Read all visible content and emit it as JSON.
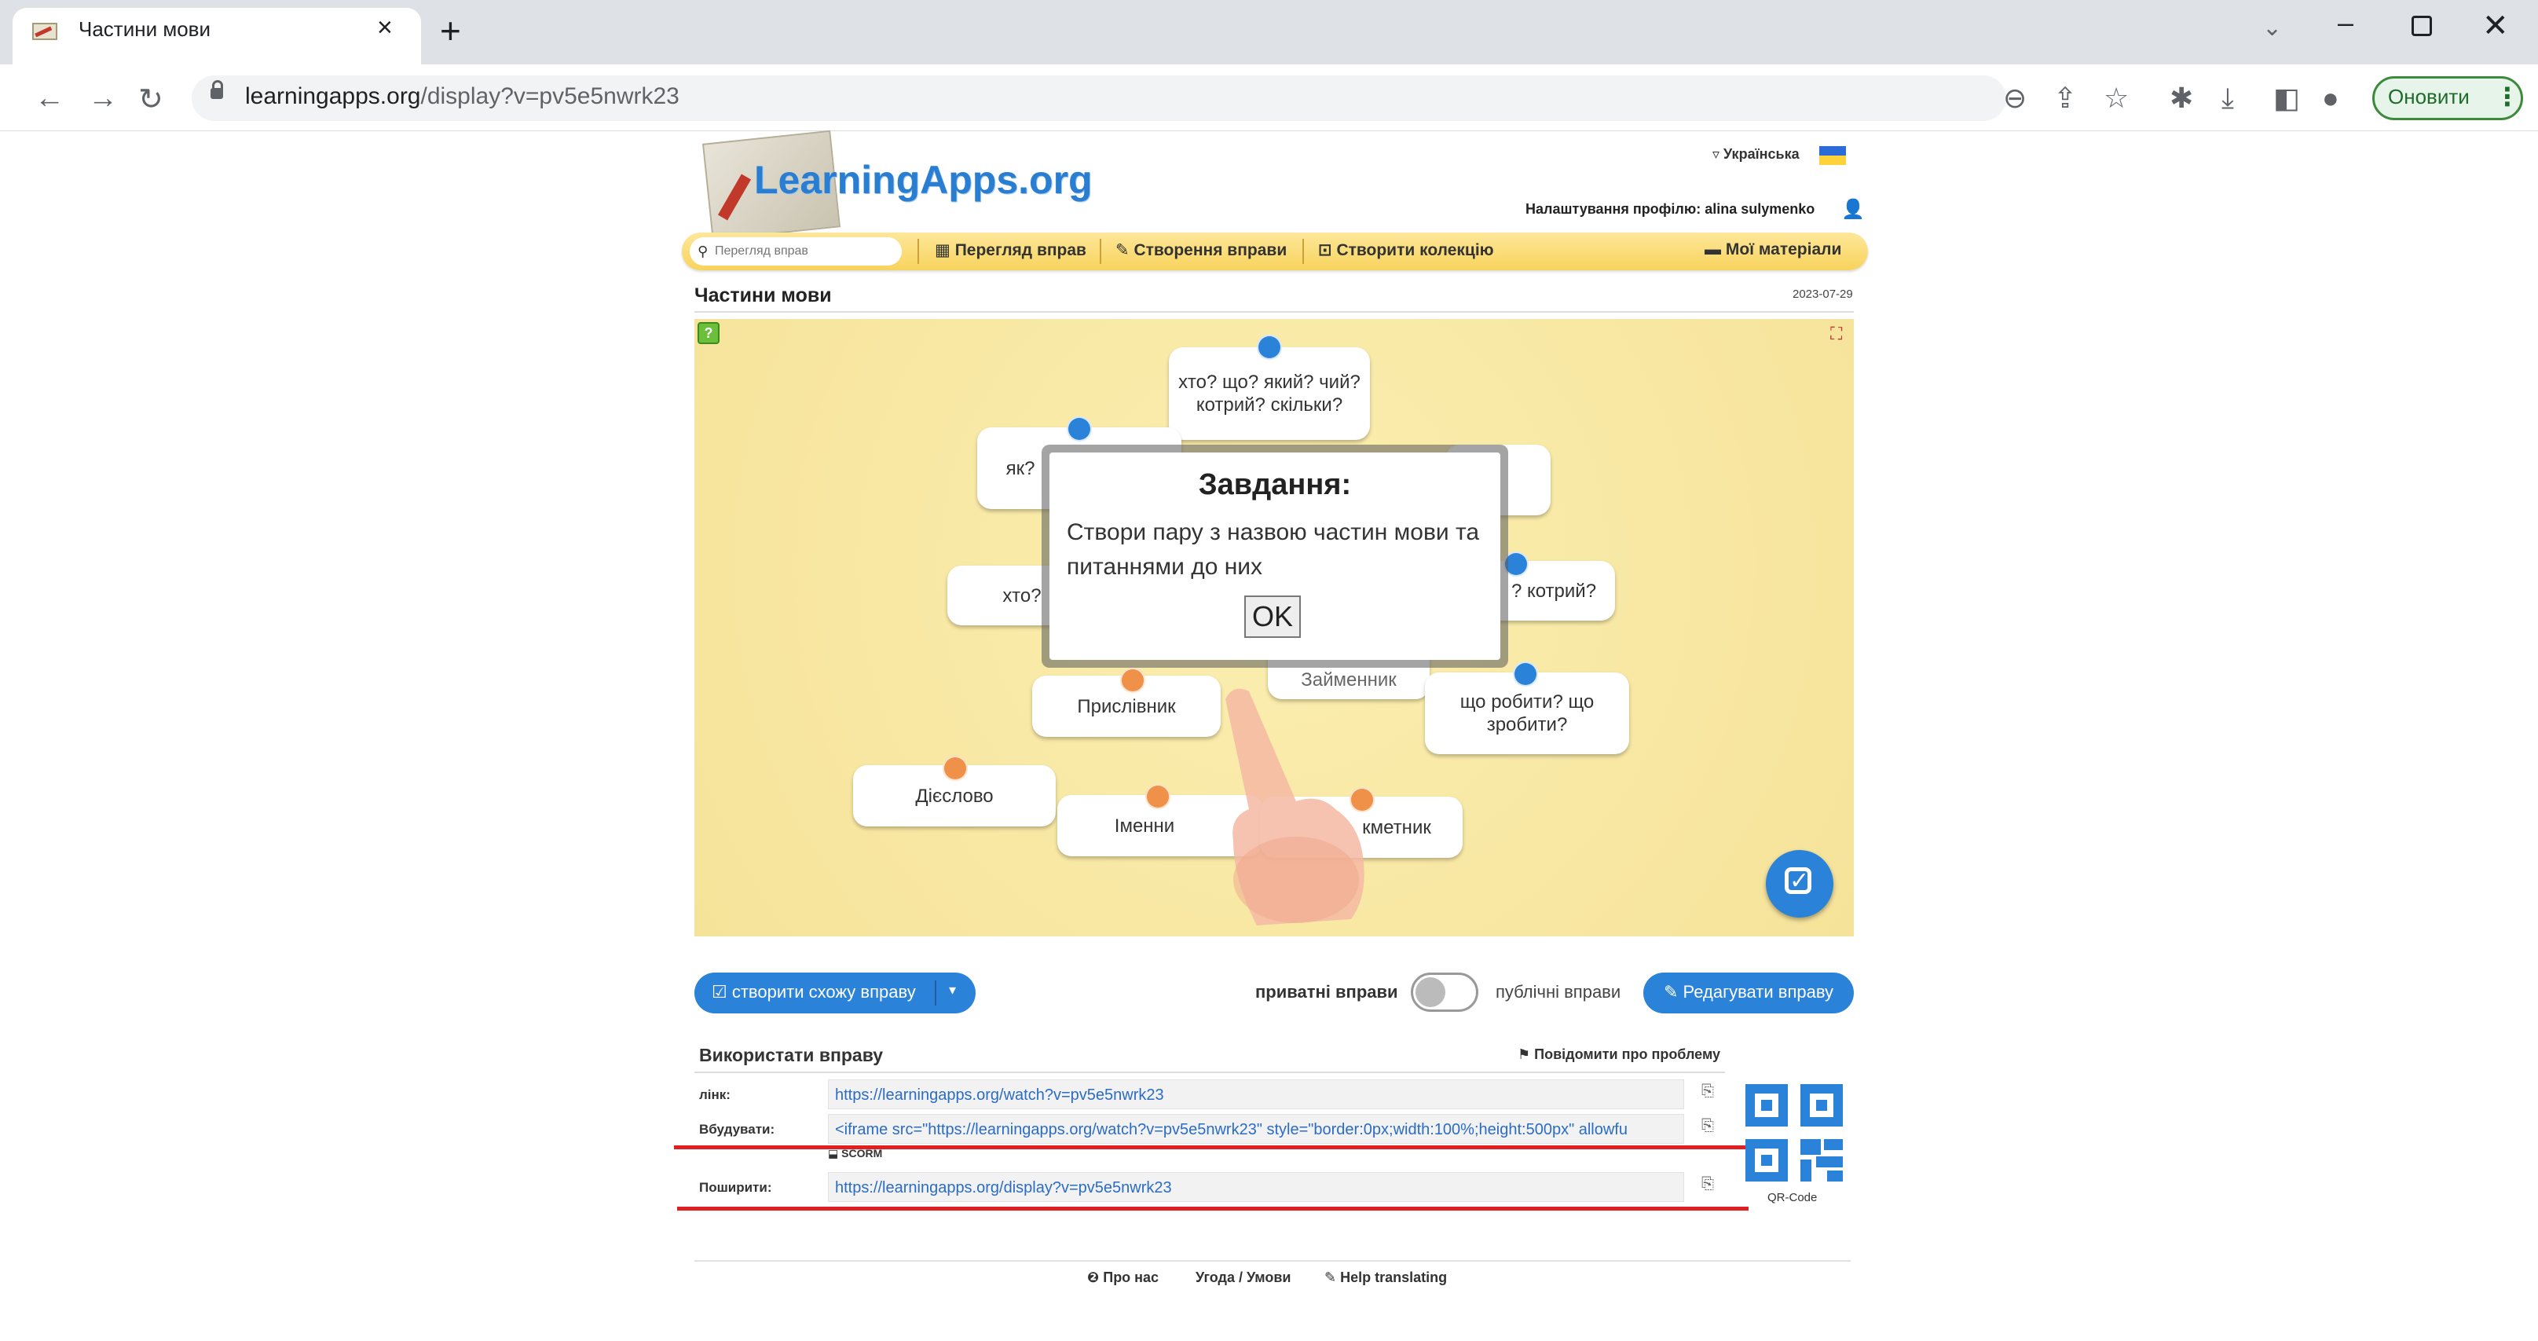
{
  "browser": {
    "tab_title": "Частини мови",
    "url_host": "learningapps.org",
    "url_path": "/display?v=pv5e5nwrk23",
    "update_label": "Оновити"
  },
  "site": {
    "logo": "LearningApps.org",
    "language": "Українська",
    "profile": "Налаштування профілю: alina sulymenko",
    "search_placeholder": "Перегляд вправ",
    "nav": {
      "browse": "Перегляд вправ",
      "create": "Створення вправи",
      "collection": "Створити колекцію",
      "my_materials": "Мої матеріали"
    }
  },
  "exercise": {
    "title": "Частини мови",
    "date": "2023-07-29",
    "cards": {
      "questions_main": "хто? що? який? чий? котрий? скільки?",
      "card_yak": "як?",
      "card_xto": "хто?",
      "card_kotryi": "? котрий?",
      "card_zaimennyk": "Займенник",
      "card_pryslivnyk": "Прислівник",
      "card_scho_robyty": "що робити? що зробити?",
      "card_diieslovo": "Дієслово",
      "card_imennyk": "Іменни",
      "card_prykmetnyk": "кметник"
    },
    "dialog": {
      "title": "Завдання:",
      "text": "Створи пару з назвою частин мови та питаннями до них",
      "ok": "OK"
    }
  },
  "actions": {
    "create_similar": "створити схожу вправу",
    "private": "приватні вправи",
    "public": "публічні вправи",
    "edit": "Редагувати вправу"
  },
  "use": {
    "title": "Використати вправу",
    "report": "Повідомити про проблему",
    "link_label": "лінк:",
    "link_value": "https://learningapps.org/watch?v=pv5e5nwrk23",
    "embed_label": "Вбудувати:",
    "embed_value": "<iframe src=\"https://learningapps.org/watch?v=pv5e5nwrk23\" style=\"border:0px;width:100%;height:500px\" allowfu",
    "scorm": "SCORM",
    "share_label": "Поширити:",
    "share_value": "https://learningapps.org/display?v=pv5e5nwrk23",
    "qr_label": "QR-Code"
  },
  "footer": {
    "about": "Про нас",
    "terms": "Угода / Умови",
    "help": "Help translating"
  },
  "colors": {
    "accent": "#2b82d9",
    "navbar": "#f8d35c",
    "game_bg": "#f6e39a",
    "pin_blue": "#2b82d9",
    "pin_orange": "#f0914a",
    "highlight": "#e02020"
  }
}
